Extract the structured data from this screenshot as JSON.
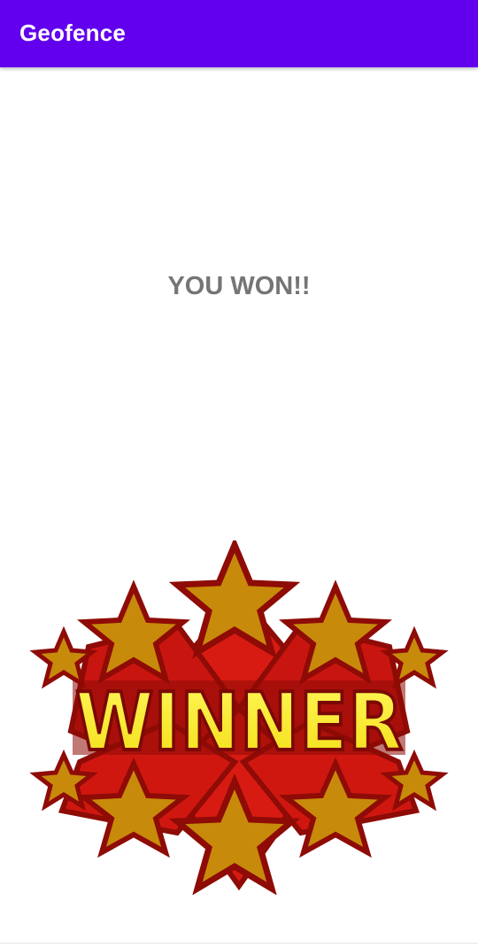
{
  "app_bar": {
    "title": "Geofence",
    "color": "#6200ee"
  },
  "main": {
    "message": "YOU WON!!",
    "message_color": "#757575"
  },
  "winner_image": {
    "text": "WINNER",
    "colors": {
      "red": "#d81b12",
      "dark_red": "#8e0b06",
      "gold": "#c88a0a",
      "yellow": "#ffef2e"
    }
  }
}
